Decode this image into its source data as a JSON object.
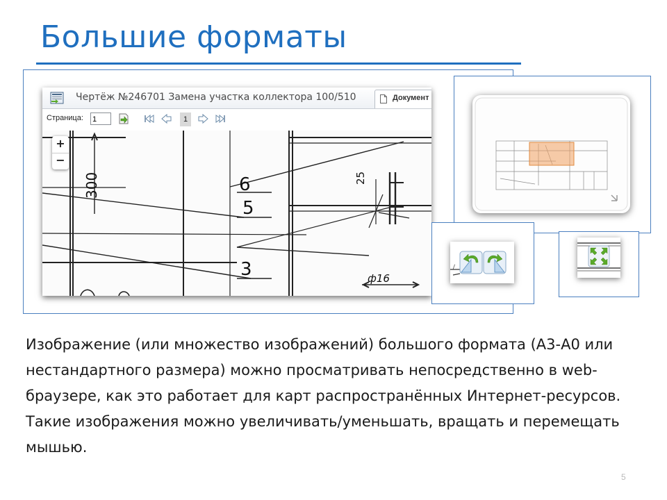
{
  "slide": {
    "title": "Большие форматы",
    "page_number": "5"
  },
  "viewer": {
    "title": "Чертёж №246701 Замена участка коллектора 100/510",
    "tab_document": "Документ",
    "page_label": "Страница:",
    "page_input_value": "1",
    "current_page": "1",
    "zoom_in": "+",
    "zoom_out": "−"
  },
  "drawing": {
    "dim_300": "300",
    "dim_25": "25",
    "label_6": "6",
    "label_5": "5",
    "label_3": "3",
    "dim_phi16": "ф16"
  },
  "icons": {
    "app": "document-app-icon",
    "tab": "document-tab-icon",
    "go": "go-page-icon",
    "first": "first-page-icon",
    "prev": "prev-page-icon",
    "next": "next-page-icon",
    "last": "last-page-icon",
    "rotate_left": "rotate-left-icon",
    "rotate_right": "rotate-right-icon",
    "fullscreen": "fullscreen-icon"
  },
  "colors": {
    "accent": "#1f6fbf",
    "frame": "#4a7fbf",
    "green_icon": "#5aaa2a",
    "overview_highlight": "#f0a060"
  },
  "body": {
    "paragraph1": "Изображение (или множество изображений) большого формата (А3-А0 или нестандартного размера) можно просматривать непосредственно в web-браузере, как это работает для карт распространённых Интернет-ресурсов.",
    "paragraph2": "Такие изображения можно увеличивать/уменьшать, вращать и перемещать мышью."
  }
}
